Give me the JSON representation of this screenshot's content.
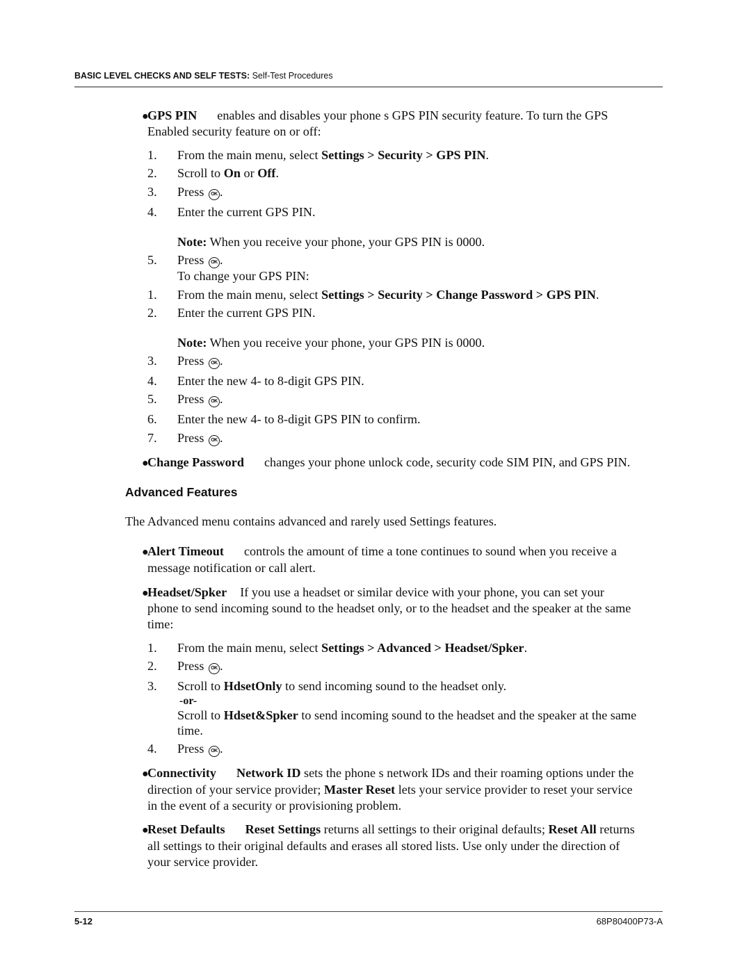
{
  "header": {
    "section": "BASIC LEVEL CHECKS AND SELF TESTS:",
    "subsection": "Self-Test Procedures"
  },
  "gps_pin": {
    "term": "GPS PIN",
    "desc_line1": "enables and disables your phone s GPS PIN security feature. To turn the GPS",
    "desc_line2": "Enabled security feature on or off:",
    "steps": [
      {
        "num": "1.",
        "pre": "From the main menu, select ",
        "bold": "Settings > Security > GPS PIN",
        "post": "."
      },
      {
        "num": "2.",
        "pre": "Scroll to ",
        "bold": "On",
        "mid": " or ",
        "bold2": "Off",
        "post": "."
      },
      {
        "num": "3.",
        "pre": "Press ",
        "post": "."
      },
      {
        "num": "4.",
        "pre": "Enter the current GPS PIN."
      }
    ],
    "note1_label": "Note:",
    "note1_text": " When you receive your phone, your GPS PIN is 0000.",
    "step5_num": "5.",
    "step5_text": "Press ",
    "change_intro": "To change your GPS PIN:",
    "change_steps": [
      {
        "num": "1.",
        "pre": "From the main menu, select ",
        "bold": "Settings > Security > Change Password > GPS PIN",
        "post": "."
      },
      {
        "num": "2.",
        "pre": "Enter the current GPS PIN."
      }
    ],
    "note2_label": "Note:",
    "note2_text": " When you receive your phone, your GPS PIN is 0000.",
    "change_steps2": [
      {
        "num": "3.",
        "pre": "Press ",
        "ok": true
      },
      {
        "num": "4.",
        "pre": "Enter the new 4- to 8-digit GPS PIN."
      },
      {
        "num": "5.",
        "pre": "Press ",
        "ok": true
      },
      {
        "num": "6.",
        "pre": "Enter the new 4- to 8-digit GPS PIN to confirm."
      },
      {
        "num": "7.",
        "pre": "Press ",
        "ok": true
      }
    ]
  },
  "change_password": {
    "term": "Change Password",
    "desc": "changes your phone unlock code, security code SIM PIN, and GPS PIN."
  },
  "advanced": {
    "title": "Advanced Features",
    "intro": "The Advanced menu contains advanced and rarely used Settings features.",
    "alert_timeout": {
      "term": "Alert Timeout",
      "line1": "controls the amount of time a tone continues to sound when you receive a",
      "line2": "message notification or call alert."
    },
    "headset": {
      "term": "Headset/Spker",
      "line1": "If you use a headset or similar device with your phone, you can set your",
      "line2": "phone to send incoming sound to the headset only, or to the headset and the speaker at the same",
      "line3": "time:",
      "step1_pre": "From the main menu, select ",
      "step1_bold": "Settings > Advanced > Headset/Spker",
      "step2_pre": "Press ",
      "step3_pre": "Scroll to ",
      "step3_bold": "HdsetOnly",
      "step3_post": " to send incoming sound to the headset only.",
      "or": "-or-",
      "alt_pre": "Scroll to ",
      "alt_bold": "Hdset&Spker",
      "alt_post": " to send incoming sound to the headset and the speaker at the same",
      "alt_line2": "time.",
      "step4_pre": "Press "
    },
    "connectivity": {
      "term": "Connectivity",
      "b1": "Network ID",
      "t1": " sets the phone s network IDs and their roaming options under the",
      "t2a": "direction of your service provider; ",
      "b2": "Master Reset",
      "t2b": " lets your service provider to reset your service",
      "t3": "in the event of a security or provisioning problem."
    },
    "reset_defaults": {
      "term": "Reset Defaults",
      "b1": "Reset Settings",
      "t1": " returns all settings to their original defaults; ",
      "b2": "Reset All",
      "t1b": " returns",
      "t2": "all settings to their original defaults and erases all stored lists. Use only under the direction of",
      "t3": "your service provider."
    }
  },
  "ok_label": "OK",
  "footer": {
    "page": "5-12",
    "doc_id": "68P80400P73-A"
  }
}
